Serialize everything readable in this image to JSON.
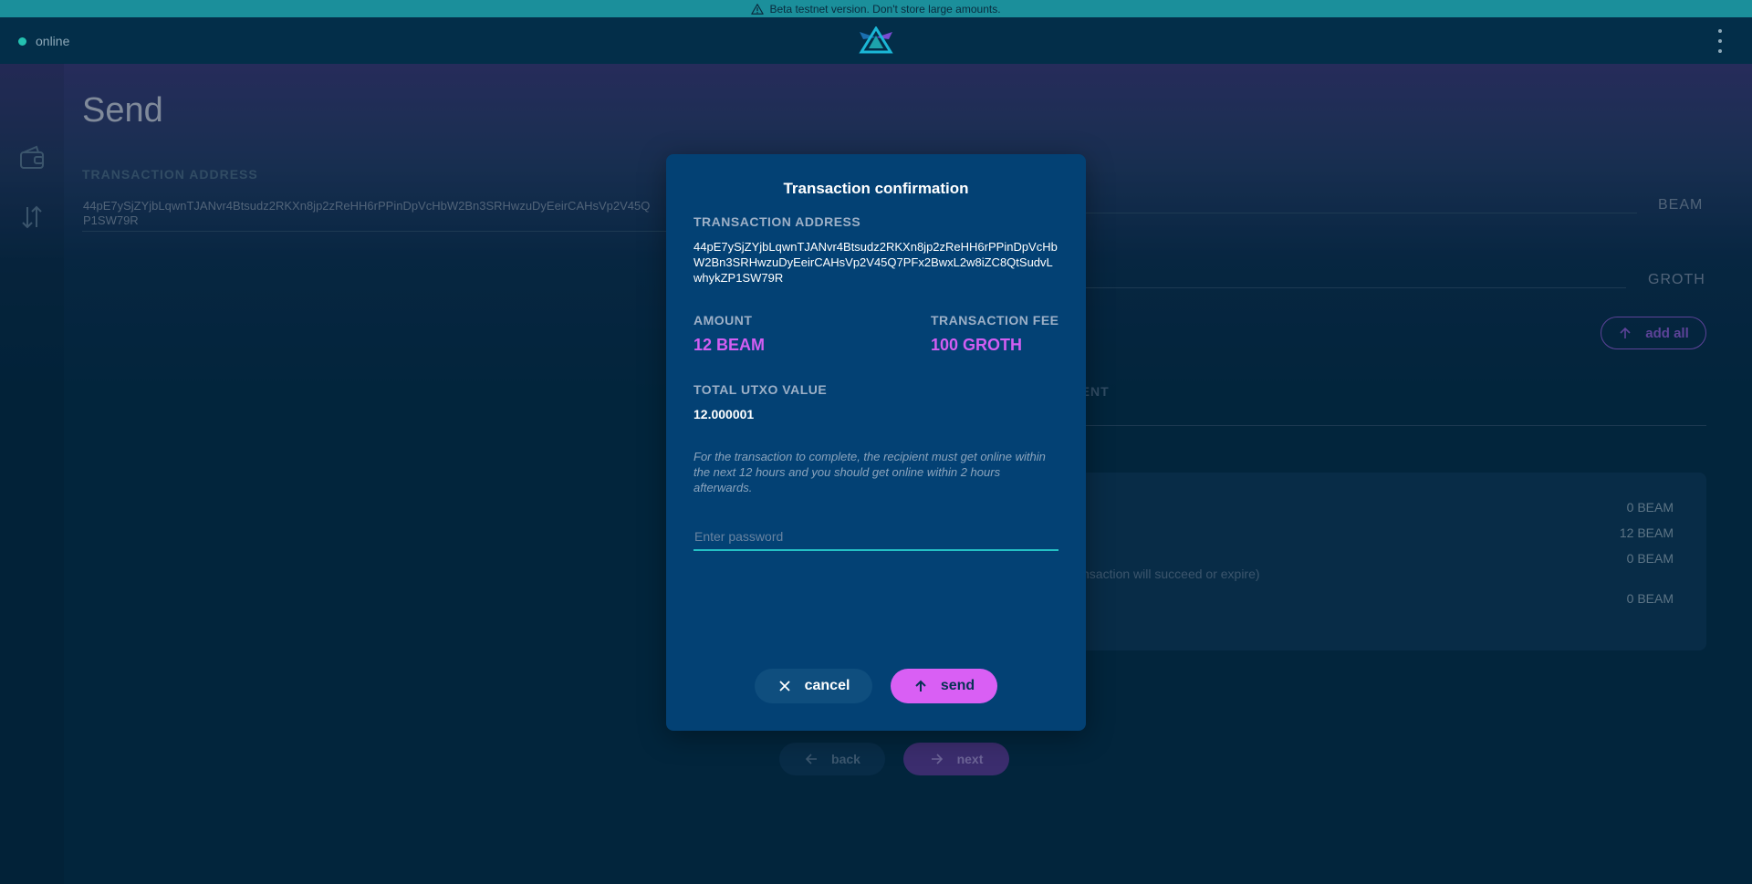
{
  "banner": {
    "text": "Beta testnet version. Don't store large amounts."
  },
  "header": {
    "status": "online"
  },
  "page": {
    "title": "Send",
    "transaction_address_label": "TRANSACTION ADDRESS",
    "address_value_line1": "44pE7ySjZYjbLqwnTJANvr4Btsudz2RKXn8jp2zReHH6rPPinDpVcHbW2Bn3SRHwzuDyEeirCAHsVp2V45Q",
    "address_value_line2": "P1SW79R",
    "beam_unit": "BEAM",
    "groth_unit": "GROTH",
    "add_all_label": "add all",
    "comment_label_partial": "MENT",
    "summary": {
      "v1": "0 BEAM",
      "v2": "12 BEAM",
      "v3": "0 BEAM",
      "note": "e transaction will succeed or expire)",
      "v4": "0 BEAM"
    },
    "back_label": "back",
    "next_label": "next"
  },
  "modal": {
    "title": "Transaction confirmation",
    "address_label": "TRANSACTION ADDRESS",
    "address_value": "44pE7ySjZYjbLqwnTJANvr4Btsudz2RKXn8jp2zReHH6rPPinDpVcHbW2Bn3SRHwzuDyEeirCAHsVp2V45Q7PFx2BwxL2w8iZC8QtSudvLwhykZP1SW79R",
    "amount_label": "AMOUNT",
    "amount_value": "12 BEAM",
    "fee_label": "TRANSACTION FEE",
    "fee_value": "100 GROTH",
    "utxo_label": "TOTAL UTXO VALUE",
    "utxo_value": "12.000001",
    "info_text": "For the transaction to complete, the recipient must get online within the next 12 hours and you should get online within 2 hours afterwards.",
    "password_placeholder": "Enter password",
    "cancel_label": "cancel",
    "send_label": "send"
  },
  "colors": {
    "accent_teal": "#24c1c5",
    "accent_pink": "#d95ff4",
    "modal_bg": "#034174",
    "page_bg": "#032e49"
  }
}
